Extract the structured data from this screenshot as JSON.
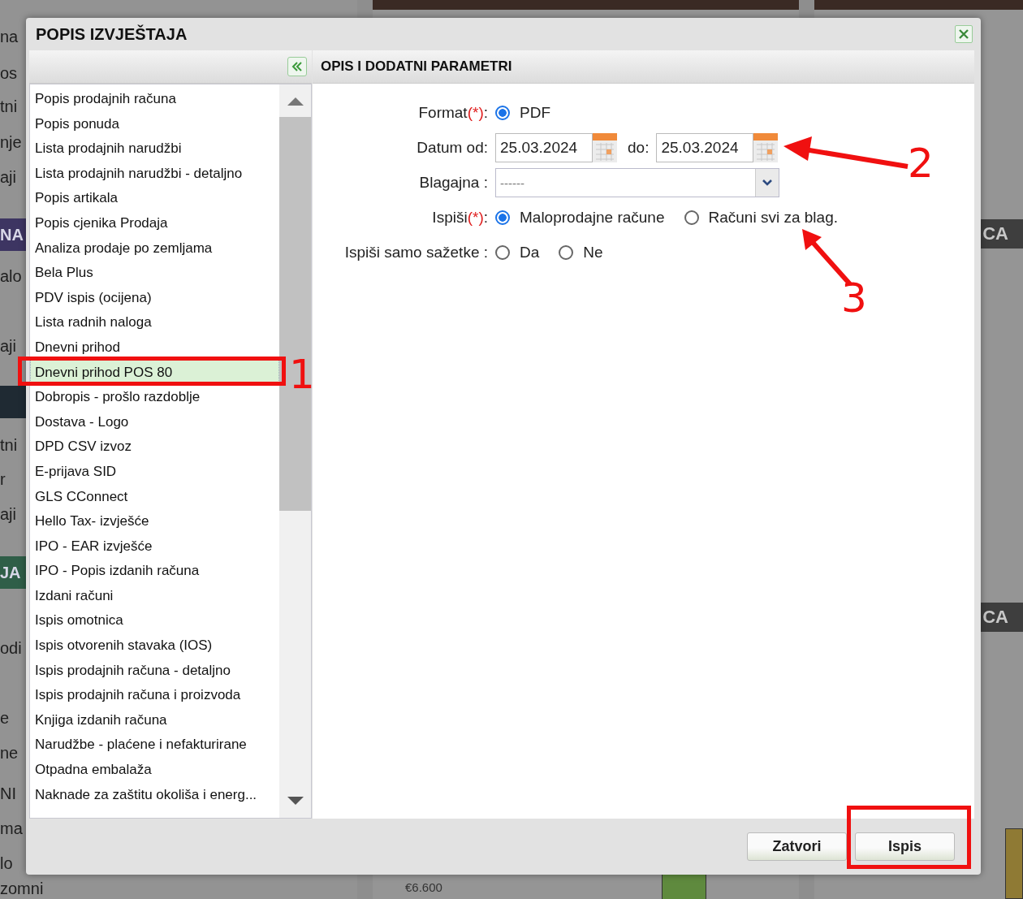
{
  "background": {
    "left_fragments": [
      {
        "text": "na",
        "kind": "text"
      },
      {
        "text": "os",
        "kind": "text"
      },
      {
        "text": "tni",
        "kind": "text"
      },
      {
        "text": "nje",
        "kind": "text"
      },
      {
        "text": "aji",
        "kind": "text"
      },
      {
        "text": "NA",
        "kind": "banner",
        "color": "#3d3562"
      },
      {
        "text": "alo",
        "kind": "text"
      },
      {
        "text": "aji",
        "kind": "text"
      },
      {
        "kind": "banner",
        "color": "#1f2a33"
      },
      {
        "text": "tni",
        "kind": "text"
      },
      {
        "text": "r",
        "kind": "text"
      },
      {
        "text": "aji",
        "kind": "text"
      },
      {
        "text": "JA",
        "kind": "banner",
        "color": "#2f5e48"
      },
      {
        "text": "odi",
        "kind": "text"
      },
      {
        "text": "e",
        "kind": "text"
      },
      {
        "text": "ne",
        "kind": "text"
      },
      {
        "text": "NI",
        "kind": "text"
      },
      {
        "text": "ma",
        "kind": "text"
      },
      {
        "text": "lo",
        "kind": "text"
      },
      {
        "text": "zomni",
        "kind": "text"
      }
    ],
    "axis_labels": [
      "€6.600"
    ],
    "right_headings": [
      "CA",
      "CA"
    ]
  },
  "dialog": {
    "title": "POPIS IZVJEŠTAJA",
    "reports": [
      {
        "label": "Popis prodajnih računa",
        "selected": false
      },
      {
        "label": "Popis ponuda",
        "selected": false
      },
      {
        "label": "Lista prodajnih narudžbi",
        "selected": false
      },
      {
        "label": "Lista prodajnih narudžbi - detaljno",
        "selected": false
      },
      {
        "label": "Popis artikala",
        "selected": false
      },
      {
        "label": "Popis cjenika Prodaja",
        "selected": false
      },
      {
        "label": "Analiza prodaje po zemljama",
        "selected": false
      },
      {
        "label": "Bela Plus",
        "selected": false
      },
      {
        "label": "PDV ispis (ocijena)",
        "selected": false
      },
      {
        "label": "Lista radnih naloga",
        "selected": false
      },
      {
        "label": "Dnevni prihod",
        "selected": false
      },
      {
        "label": "Dnevni prihod POS 80",
        "selected": true
      },
      {
        "label": "Dobropis - prošlo razdoblje",
        "selected": false
      },
      {
        "label": "Dostava - Logo",
        "selected": false
      },
      {
        "label": "DPD CSV izvoz",
        "selected": false
      },
      {
        "label": "E-prijava SID",
        "selected": false
      },
      {
        "label": "GLS CConnect",
        "selected": false
      },
      {
        "label": "Hello Tax- izvješće",
        "selected": false
      },
      {
        "label": "IPO - EAR izvješće",
        "selected": false
      },
      {
        "label": "IPO - Popis izdanih računa",
        "selected": false
      },
      {
        "label": "Izdani računi",
        "selected": false
      },
      {
        "label": "Ispis omotnica",
        "selected": false
      },
      {
        "label": "Ispis otvorenih stavaka (IOS)",
        "selected": false
      },
      {
        "label": "Ispis prodajnih računa - detaljno",
        "selected": false
      },
      {
        "label": "Ispis prodajnih računa i proizvoda",
        "selected": false
      },
      {
        "label": "Knjiga izdanih računa",
        "selected": false
      },
      {
        "label": "Narudžbe - plaćene i nefakturirane",
        "selected": false
      },
      {
        "label": "Otpadna embalaža",
        "selected": false
      },
      {
        "label": "Naknade za zaštitu okoliša i energ...",
        "selected": false
      }
    ],
    "form": {
      "title": "OPIS I DODATNI PARAMETRI",
      "rows": [
        {
          "kind": "radios",
          "label": "Format",
          "required": "(*)",
          "suffix": ":",
          "options": [
            {
              "label": "PDF",
              "selected": true
            }
          ]
        },
        {
          "kind": "dates",
          "label": "Datum od:",
          "from": "25.03.2024",
          "to_label": "do:",
          "to": "25.03.2024"
        },
        {
          "kind": "select",
          "label": "Blagajna :",
          "value": "------"
        },
        {
          "kind": "radios",
          "label": "Ispiši",
          "required": "(*)",
          "suffix": ":",
          "options": [
            {
              "label": "Maloprodajne račune",
              "selected": true
            },
            {
              "label": "Računi svi za blag.",
              "selected": false
            }
          ]
        },
        {
          "kind": "radios",
          "label": "Ispiši samo sažetke :",
          "options": [
            {
              "label": "Da",
              "selected": false
            },
            {
              "label": "Ne",
              "selected": false
            }
          ]
        }
      ]
    },
    "buttons": [
      "Zatvori",
      "Ispis"
    ]
  },
  "annotations": [
    {
      "kind": "box",
      "label": "1"
    },
    {
      "kind": "arrow",
      "label": "2"
    },
    {
      "kind": "arrow",
      "label": "3"
    },
    {
      "kind": "box"
    }
  ]
}
